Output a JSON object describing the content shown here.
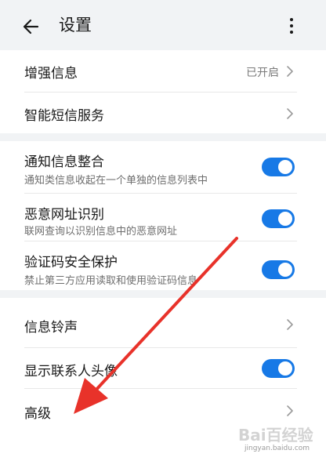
{
  "header": {
    "title": "设置",
    "back_icon": "arrow-left-icon",
    "more_icon": "more-vertical-icon"
  },
  "sections": [
    {
      "items": [
        {
          "title": "增强信息",
          "value": "已开启",
          "control": "chevron"
        },
        {
          "title": "智能短信服务",
          "control": "chevron"
        }
      ]
    },
    {
      "items": [
        {
          "title": "通知信息整合",
          "subtitle": "通知类信息收起在一个单独的信息列表中",
          "control": "toggle",
          "enabled": true
        },
        {
          "title": "恶意网址识别",
          "subtitle": "联网查询以识别信息中的恶意网址",
          "control": "toggle",
          "enabled": true
        },
        {
          "title": "验证码安全保护",
          "subtitle": "禁止第三方应用读取和使用验证码信息",
          "control": "toggle",
          "enabled": true
        }
      ]
    },
    {
      "items": [
        {
          "title": "信息铃声",
          "control": "chevron"
        },
        {
          "title": "显示联系人头像",
          "control": "toggle",
          "enabled": true
        },
        {
          "title": "高级",
          "control": "chevron"
        }
      ]
    }
  ],
  "colors": {
    "accent": "#1779e6",
    "annotation_arrow": "#e8322a",
    "background": "#f1f3f5"
  },
  "watermark": {
    "logo_text": "Bai百经验",
    "site_text": "jingyan.baidu.com"
  }
}
